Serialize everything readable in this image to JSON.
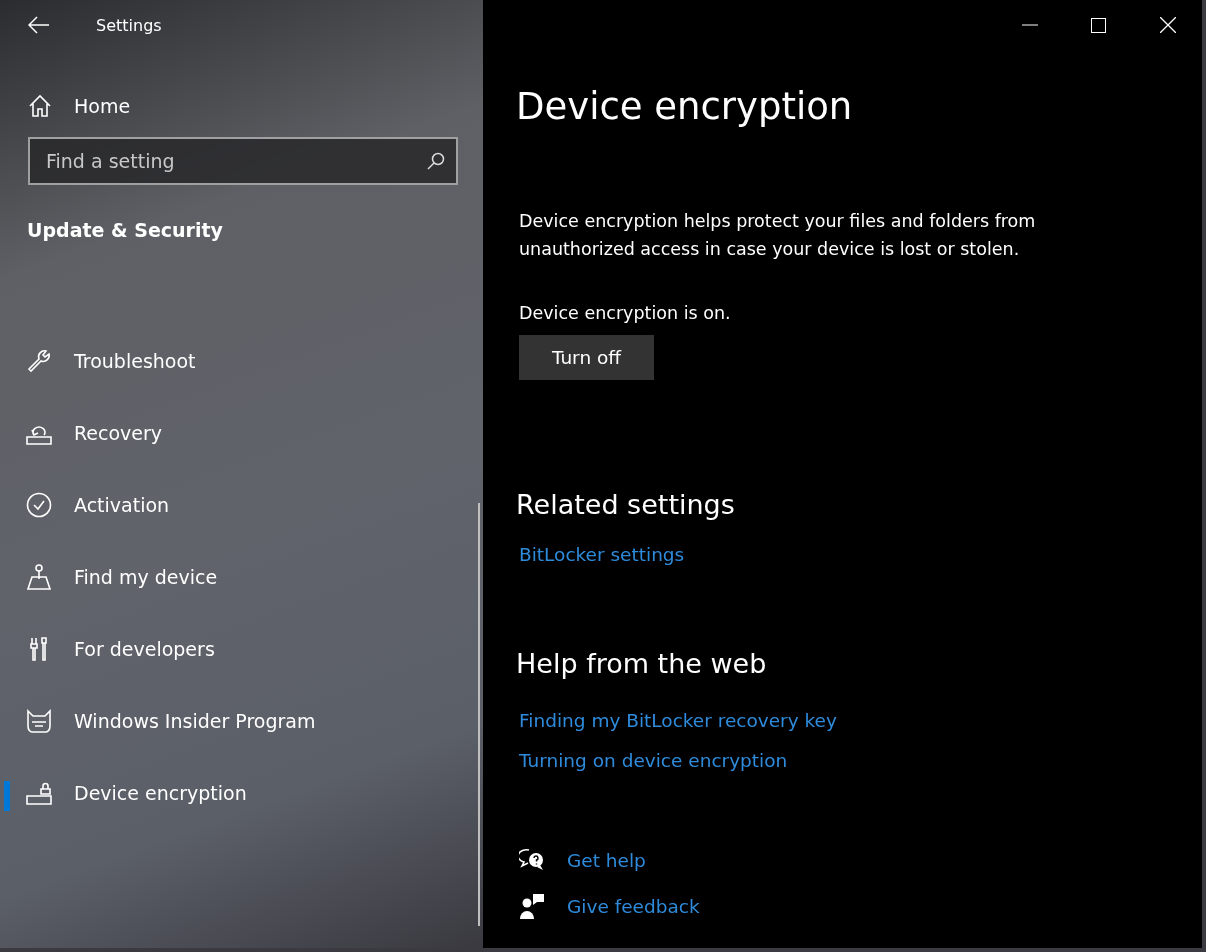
{
  "window": {
    "title": "Settings"
  },
  "sidebar": {
    "home": "Home",
    "search": {
      "placeholder": "Find a setting"
    },
    "section": "Update & Security",
    "items": [
      {
        "label": "Troubleshoot",
        "selected": false
      },
      {
        "label": "Recovery",
        "selected": false
      },
      {
        "label": "Activation",
        "selected": false
      },
      {
        "label": "Find my device",
        "selected": false
      },
      {
        "label": "For developers",
        "selected": false
      },
      {
        "label": "Windows Insider Program",
        "selected": false
      },
      {
        "label": "Device encryption",
        "selected": true
      }
    ]
  },
  "content": {
    "title": "Device encryption",
    "description": "Device encryption helps protect your files and folders from unauthorized access in case your device is lost or stolen.",
    "status": "Device encryption is on.",
    "button": "Turn off",
    "related": {
      "heading": "Related settings",
      "links": [
        "BitLocker settings"
      ]
    },
    "help": {
      "heading": "Help from the web",
      "links": [
        "Finding my BitLocker recovery key",
        "Turning on device encryption"
      ]
    },
    "footer": [
      {
        "kind": "help",
        "label": "Get help"
      },
      {
        "kind": "feedback",
        "label": "Give feedback"
      }
    ]
  }
}
